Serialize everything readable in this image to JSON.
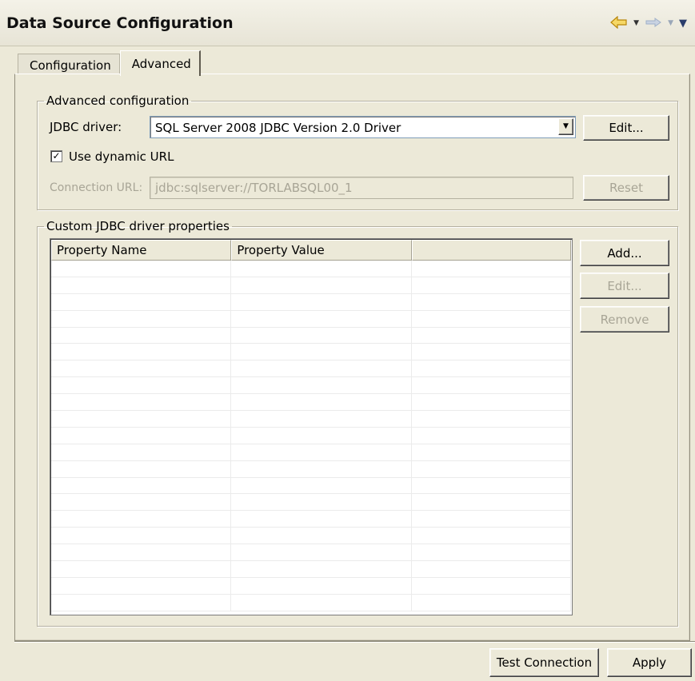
{
  "header": {
    "title": "Data Source Configuration"
  },
  "nav": {
    "back_icon": "back-arrow-icon",
    "forward_icon": "forward-arrow-icon",
    "menu_icon": "view-menu-icon"
  },
  "tabs": [
    {
      "label": "Configuration",
      "active": false
    },
    {
      "label": "Advanced",
      "active": true
    }
  ],
  "advanced": {
    "legend": "Advanced configuration",
    "jdbc_driver_label": "JDBC driver:",
    "jdbc_driver_value": "SQL Server 2008 JDBC Version 2.0 Driver",
    "edit_label": "Edit...",
    "use_dynamic_url_label": "Use dynamic URL",
    "use_dynamic_url_checked": true,
    "connection_url_label": "Connection URL:",
    "connection_url_value": "jdbc:sqlserver://TORLABSQL00_1",
    "reset_label": "Reset"
  },
  "custom": {
    "legend": "Custom JDBC driver properties",
    "columns": [
      "Property Name",
      "Property Value",
      ""
    ],
    "rows": [],
    "add_label": "Add...",
    "edit_label": "Edit...",
    "remove_label": "Remove"
  },
  "footer": {
    "test_connection_label": "Test Connection",
    "apply_label": "Apply"
  }
}
